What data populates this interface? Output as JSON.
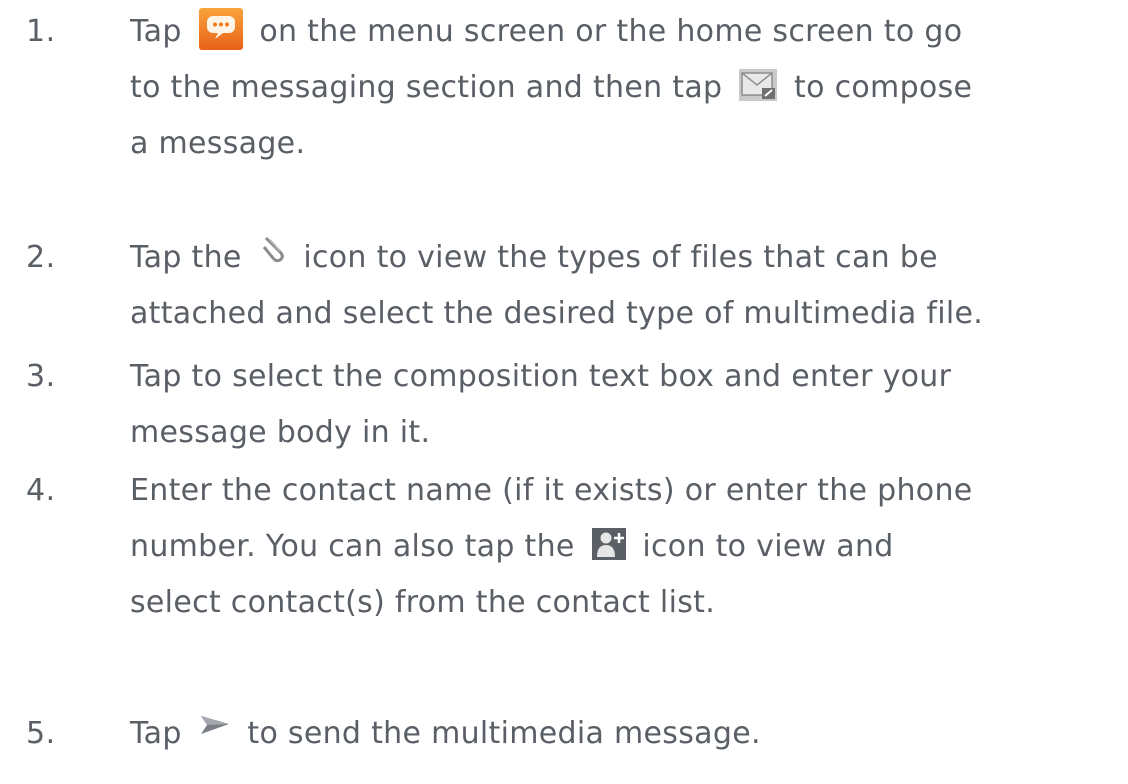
{
  "steps": [
    {
      "number": "1.",
      "lines": [
        {
          "a": "Tap",
          "icon": "messaging-app-icon",
          "b": "on the menu screen or the home screen to go"
        },
        {
          "a": "to the messaging section and then tap",
          "icon": "compose-message-icon",
          "b": "to compose"
        },
        {
          "a": "a message."
        }
      ]
    },
    {
      "number": "2.",
      "lines": [
        {
          "a": "Tap the",
          "icon": "paperclip-attach-icon",
          "b": "icon to view the types of files that can be"
        },
        {
          "a": "attached and select the desired type of multimedia file."
        }
      ]
    },
    {
      "number": "3.",
      "lines": [
        {
          "a": "Tap to select the composition text box and enter your"
        },
        {
          "a": "message body in it."
        }
      ]
    },
    {
      "number": "4.",
      "lines": [
        {
          "a": "Enter the contact name (if it exists) or enter the phone"
        },
        {
          "a": "number. You can also tap the",
          "icon": "add-contact-icon",
          "b": "icon to view and"
        },
        {
          "a": "select contact(s) from the contact list."
        }
      ]
    },
    {
      "number": "5.",
      "lines": [
        {
          "a": "Tap",
          "icon": "send-arrow-icon",
          "b": "to send the multimedia message."
        }
      ]
    }
  ],
  "colors": {
    "text": "#5a5f66",
    "messaging_icon_orange": "#f07a1a",
    "compose_icon_gray": "#9a9a9a",
    "add_contact_icon_dark": "#5b6066"
  }
}
